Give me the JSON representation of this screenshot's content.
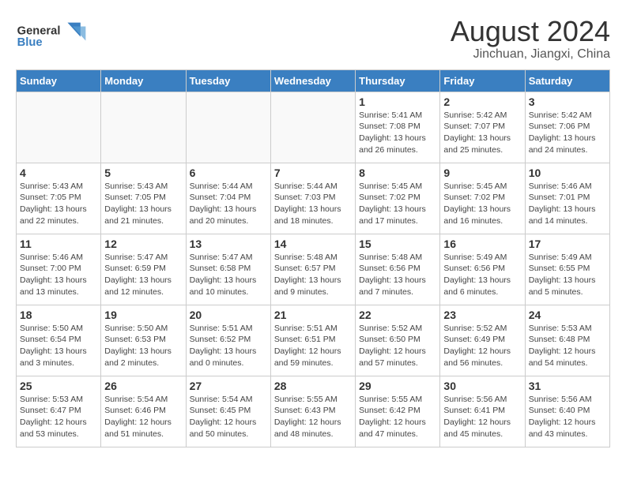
{
  "header": {
    "month_year": "August 2024",
    "location": "Jinchuan, Jiangxi, China"
  },
  "days_of_week": [
    "Sunday",
    "Monday",
    "Tuesday",
    "Wednesday",
    "Thursday",
    "Friday",
    "Saturday"
  ],
  "weeks": [
    [
      {
        "day": "",
        "info": ""
      },
      {
        "day": "",
        "info": ""
      },
      {
        "day": "",
        "info": ""
      },
      {
        "day": "",
        "info": ""
      },
      {
        "day": "1",
        "info": "Sunrise: 5:41 AM\nSunset: 7:08 PM\nDaylight: 13 hours\nand 26 minutes."
      },
      {
        "day": "2",
        "info": "Sunrise: 5:42 AM\nSunset: 7:07 PM\nDaylight: 13 hours\nand 25 minutes."
      },
      {
        "day": "3",
        "info": "Sunrise: 5:42 AM\nSunset: 7:06 PM\nDaylight: 13 hours\nand 24 minutes."
      }
    ],
    [
      {
        "day": "4",
        "info": "Sunrise: 5:43 AM\nSunset: 7:05 PM\nDaylight: 13 hours\nand 22 minutes."
      },
      {
        "day": "5",
        "info": "Sunrise: 5:43 AM\nSunset: 7:05 PM\nDaylight: 13 hours\nand 21 minutes."
      },
      {
        "day": "6",
        "info": "Sunrise: 5:44 AM\nSunset: 7:04 PM\nDaylight: 13 hours\nand 20 minutes."
      },
      {
        "day": "7",
        "info": "Sunrise: 5:44 AM\nSunset: 7:03 PM\nDaylight: 13 hours\nand 18 minutes."
      },
      {
        "day": "8",
        "info": "Sunrise: 5:45 AM\nSunset: 7:02 PM\nDaylight: 13 hours\nand 17 minutes."
      },
      {
        "day": "9",
        "info": "Sunrise: 5:45 AM\nSunset: 7:02 PM\nDaylight: 13 hours\nand 16 minutes."
      },
      {
        "day": "10",
        "info": "Sunrise: 5:46 AM\nSunset: 7:01 PM\nDaylight: 13 hours\nand 14 minutes."
      }
    ],
    [
      {
        "day": "11",
        "info": "Sunrise: 5:46 AM\nSunset: 7:00 PM\nDaylight: 13 hours\nand 13 minutes."
      },
      {
        "day": "12",
        "info": "Sunrise: 5:47 AM\nSunset: 6:59 PM\nDaylight: 13 hours\nand 12 minutes."
      },
      {
        "day": "13",
        "info": "Sunrise: 5:47 AM\nSunset: 6:58 PM\nDaylight: 13 hours\nand 10 minutes."
      },
      {
        "day": "14",
        "info": "Sunrise: 5:48 AM\nSunset: 6:57 PM\nDaylight: 13 hours\nand 9 minutes."
      },
      {
        "day": "15",
        "info": "Sunrise: 5:48 AM\nSunset: 6:56 PM\nDaylight: 13 hours\nand 7 minutes."
      },
      {
        "day": "16",
        "info": "Sunrise: 5:49 AM\nSunset: 6:56 PM\nDaylight: 13 hours\nand 6 minutes."
      },
      {
        "day": "17",
        "info": "Sunrise: 5:49 AM\nSunset: 6:55 PM\nDaylight: 13 hours\nand 5 minutes."
      }
    ],
    [
      {
        "day": "18",
        "info": "Sunrise: 5:50 AM\nSunset: 6:54 PM\nDaylight: 13 hours\nand 3 minutes."
      },
      {
        "day": "19",
        "info": "Sunrise: 5:50 AM\nSunset: 6:53 PM\nDaylight: 13 hours\nand 2 minutes."
      },
      {
        "day": "20",
        "info": "Sunrise: 5:51 AM\nSunset: 6:52 PM\nDaylight: 13 hours\nand 0 minutes."
      },
      {
        "day": "21",
        "info": "Sunrise: 5:51 AM\nSunset: 6:51 PM\nDaylight: 12 hours\nand 59 minutes."
      },
      {
        "day": "22",
        "info": "Sunrise: 5:52 AM\nSunset: 6:50 PM\nDaylight: 12 hours\nand 57 minutes."
      },
      {
        "day": "23",
        "info": "Sunrise: 5:52 AM\nSunset: 6:49 PM\nDaylight: 12 hours\nand 56 minutes."
      },
      {
        "day": "24",
        "info": "Sunrise: 5:53 AM\nSunset: 6:48 PM\nDaylight: 12 hours\nand 54 minutes."
      }
    ],
    [
      {
        "day": "25",
        "info": "Sunrise: 5:53 AM\nSunset: 6:47 PM\nDaylight: 12 hours\nand 53 minutes."
      },
      {
        "day": "26",
        "info": "Sunrise: 5:54 AM\nSunset: 6:46 PM\nDaylight: 12 hours\nand 51 minutes."
      },
      {
        "day": "27",
        "info": "Sunrise: 5:54 AM\nSunset: 6:45 PM\nDaylight: 12 hours\nand 50 minutes."
      },
      {
        "day": "28",
        "info": "Sunrise: 5:55 AM\nSunset: 6:43 PM\nDaylight: 12 hours\nand 48 minutes."
      },
      {
        "day": "29",
        "info": "Sunrise: 5:55 AM\nSunset: 6:42 PM\nDaylight: 12 hours\nand 47 minutes."
      },
      {
        "day": "30",
        "info": "Sunrise: 5:56 AM\nSunset: 6:41 PM\nDaylight: 12 hours\nand 45 minutes."
      },
      {
        "day": "31",
        "info": "Sunrise: 5:56 AM\nSunset: 6:40 PM\nDaylight: 12 hours\nand 43 minutes."
      }
    ]
  ]
}
